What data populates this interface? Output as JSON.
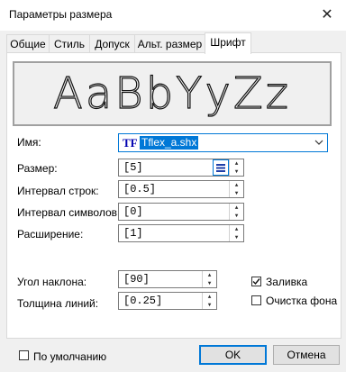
{
  "window": {
    "title": "Параметры размера",
    "close_symbol": "✕"
  },
  "tabs": [
    {
      "label": "Общие"
    },
    {
      "label": "Стиль"
    },
    {
      "label": "Допуск"
    },
    {
      "label": "Альт. размер"
    },
    {
      "label": "Шрифт",
      "active": true
    }
  ],
  "preview": {
    "sample_text": "AaBbYyZz"
  },
  "font": {
    "name_label": "Имя:",
    "name_value": "Tflex_a.shx",
    "name_icon": "TF",
    "size_label": "Размер:",
    "size_value": "[5]",
    "line_spacing_label": "Интервал строк:",
    "line_spacing_value": "[0.5]",
    "char_spacing_label": "Интервал символов:",
    "char_spacing_value": "[0]",
    "expansion_label": "Расширение:",
    "expansion_value": "[1]",
    "slant_label": "Угол наклона:",
    "slant_value": "[90]",
    "line_thickness_label": "Толщина линий:",
    "line_thickness_value": "[0.25]",
    "fill_label": "Заливка",
    "fill_checked": true,
    "clear_bg_label": "Очистка фона",
    "clear_bg_checked": false
  },
  "footer": {
    "default_label": "По умолчанию",
    "default_checked": false,
    "ok_label": "OK",
    "cancel_label": "Отмена"
  },
  "colors": {
    "accent": "#0078d7",
    "selection": "#0078d7"
  }
}
